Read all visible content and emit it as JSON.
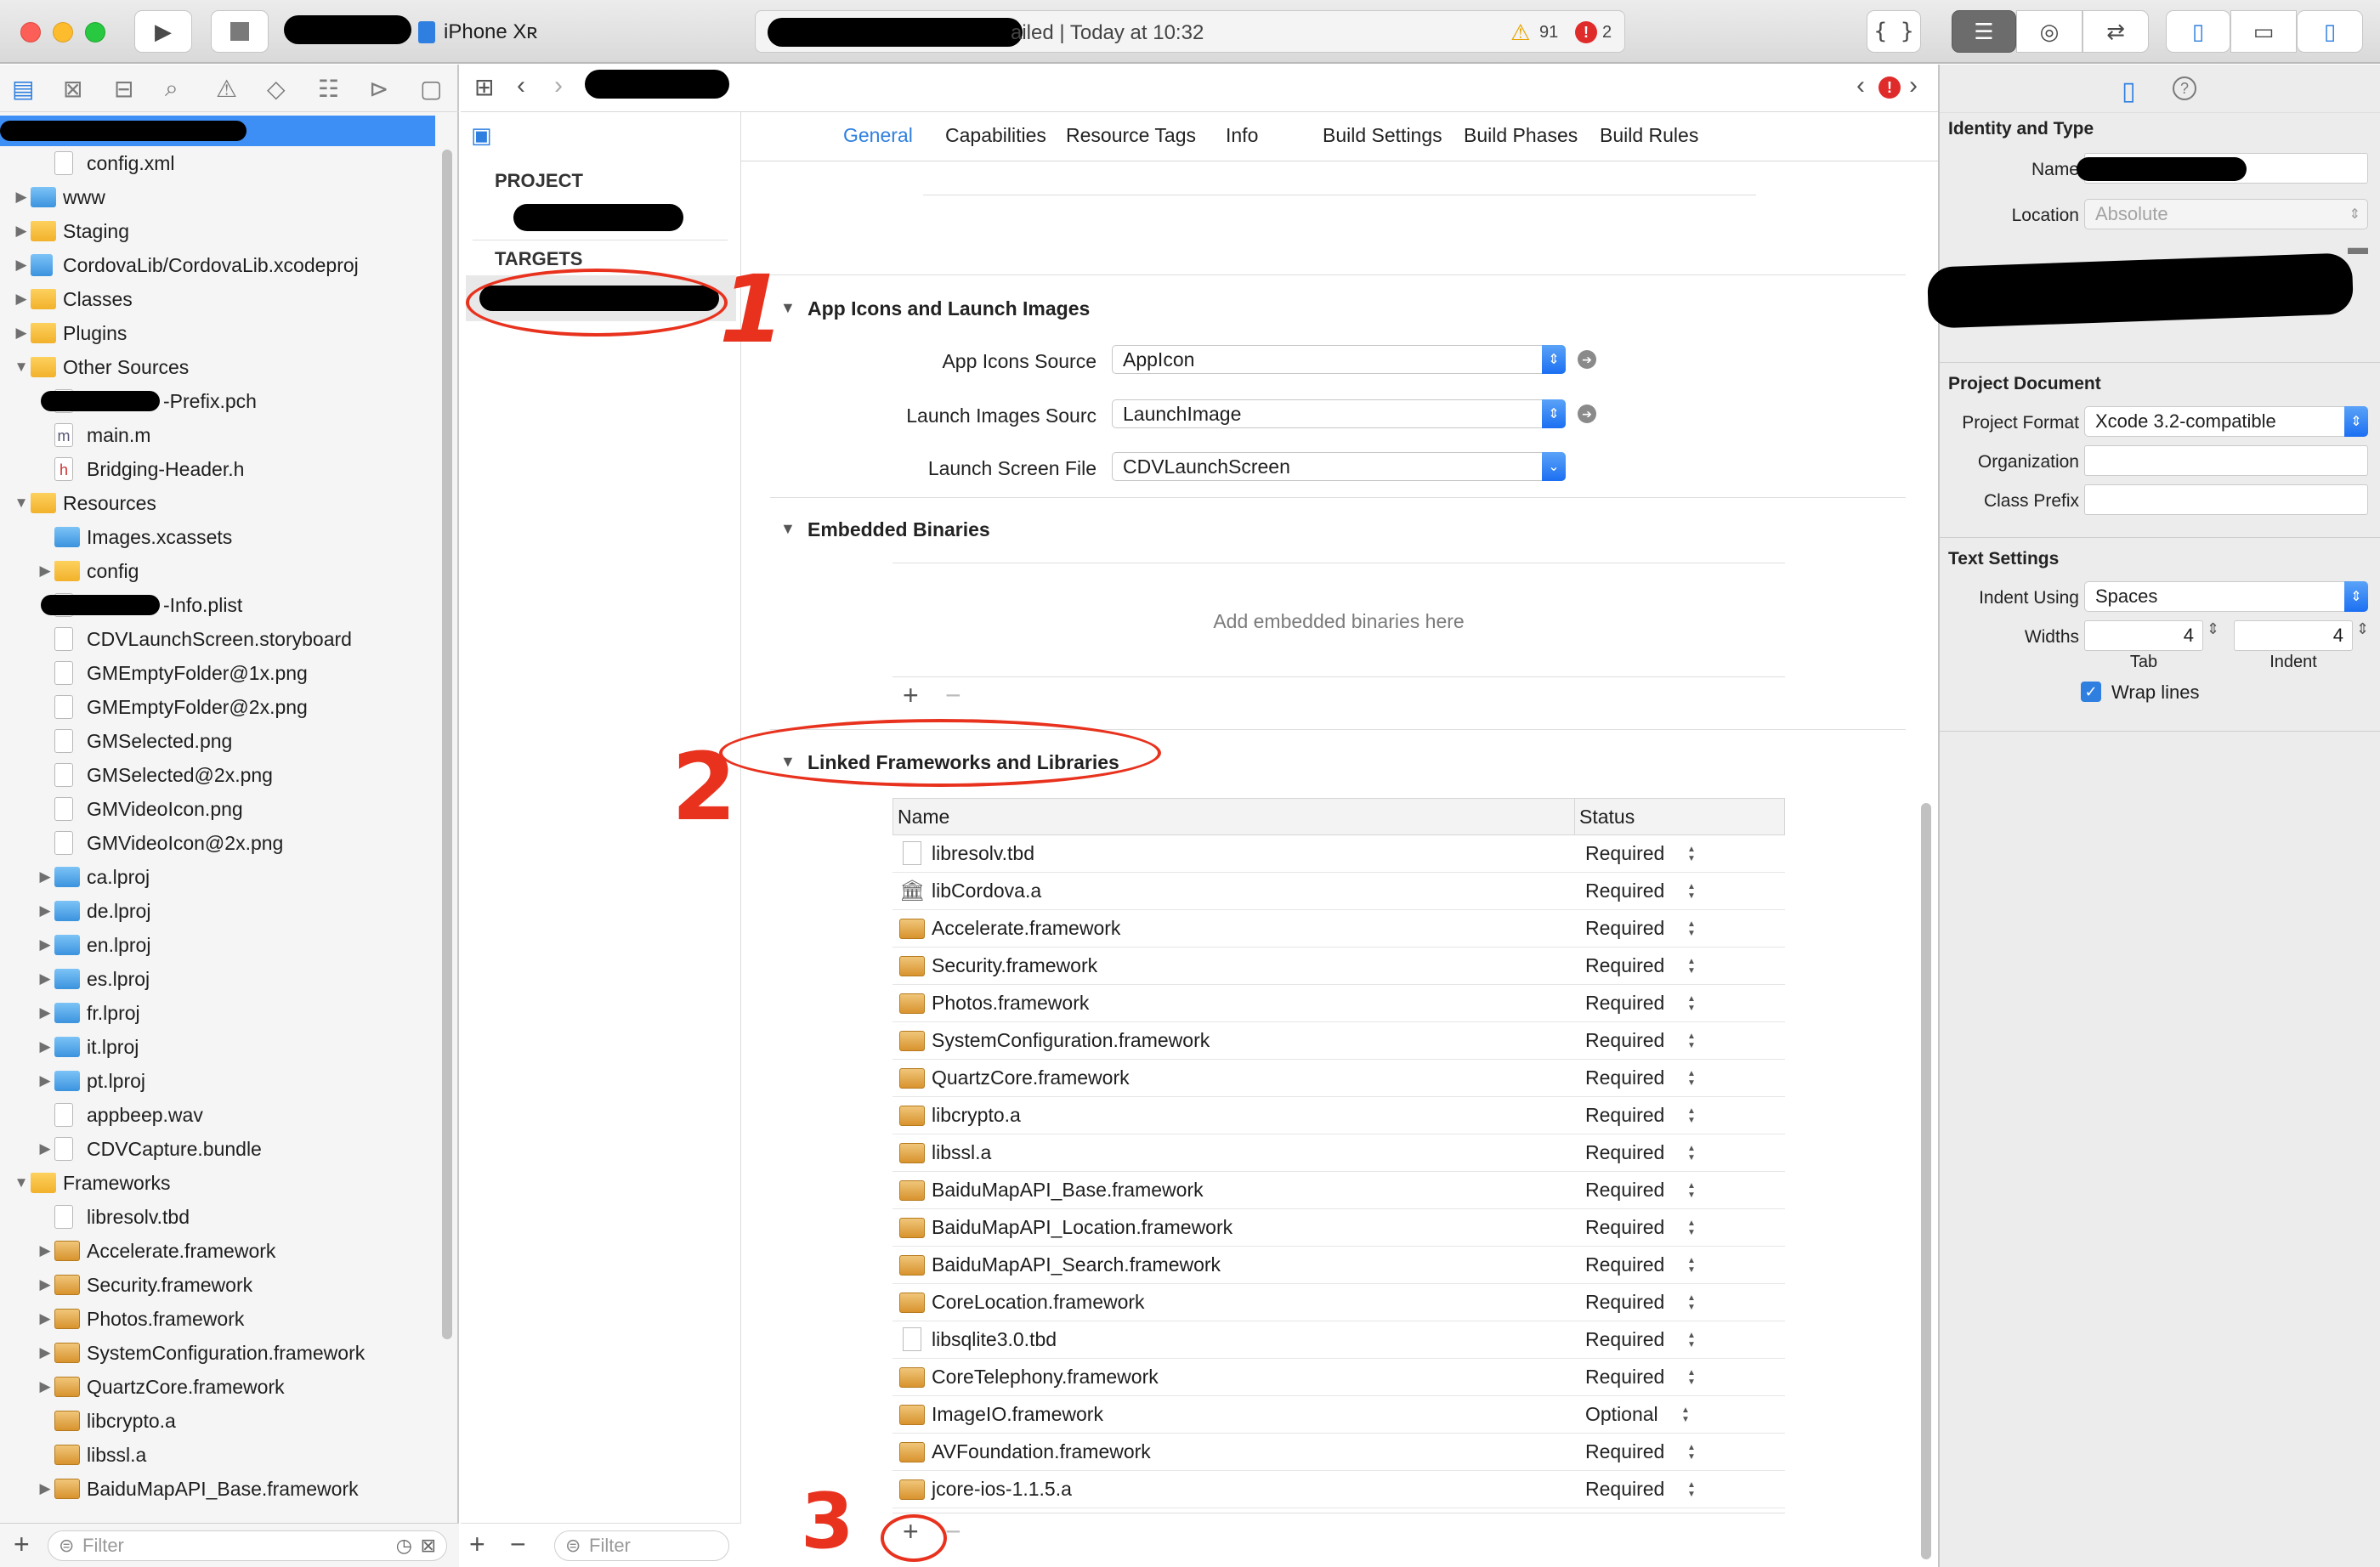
{
  "toolbar": {
    "run_icon": "play-icon",
    "stop_icon": "stop-icon",
    "scheme_device": "iPhone Xʀ",
    "activity_status": "ailed | Today at 10:32",
    "warning_count": "91",
    "error_count": "2"
  },
  "navigator": {
    "tree": [
      {
        "label": "config.xml",
        "indent": 1,
        "icon": "file",
        "disclosure": ""
      },
      {
        "label": "www",
        "indent": 0,
        "icon": "bfold",
        "disclosure": "▶"
      },
      {
        "label": "Staging",
        "indent": 0,
        "icon": "fold",
        "disclosure": "▶"
      },
      {
        "label": "CordovaLib/CordovaLib.xcodeproj",
        "indent": 0,
        "icon": "proj",
        "disclosure": "▶"
      },
      {
        "label": "Classes",
        "indent": 0,
        "icon": "fold",
        "disclosure": "▶"
      },
      {
        "label": "Plugins",
        "indent": 0,
        "icon": "fold",
        "disclosure": "▶"
      },
      {
        "label": "Other Sources",
        "indent": 0,
        "icon": "fold",
        "disclosure": "▼"
      },
      {
        "label": "-Prefix.pch",
        "indent": 1,
        "icon": "file",
        "disclosure": "",
        "redacted": true
      },
      {
        "label": "main.m",
        "indent": 1,
        "icon": "mfile",
        "disclosure": ""
      },
      {
        "label": "Bridging-Header.h",
        "indent": 1,
        "icon": "hfile",
        "disclosure": ""
      },
      {
        "label": "Resources",
        "indent": 0,
        "icon": "fold",
        "disclosure": "▼"
      },
      {
        "label": "Images.xcassets",
        "indent": 1,
        "icon": "bfold",
        "disclosure": ""
      },
      {
        "label": "config",
        "indent": 1,
        "icon": "fold",
        "disclosure": "▶"
      },
      {
        "label": "-Info.plist",
        "indent": 1,
        "icon": "file",
        "disclosure": "",
        "redacted": true
      },
      {
        "label": "CDVLaunchScreen.storyboard",
        "indent": 1,
        "icon": "file",
        "disclosure": ""
      },
      {
        "label": "GMEmptyFolder@1x.png",
        "indent": 1,
        "icon": "file",
        "disclosure": ""
      },
      {
        "label": "GMEmptyFolder@2x.png",
        "indent": 1,
        "icon": "file",
        "disclosure": ""
      },
      {
        "label": "GMSelected.png",
        "indent": 1,
        "icon": "file",
        "disclosure": ""
      },
      {
        "label": "GMSelected@2x.png",
        "indent": 1,
        "icon": "file",
        "disclosure": ""
      },
      {
        "label": "GMVideoIcon.png",
        "indent": 1,
        "icon": "file",
        "disclosure": ""
      },
      {
        "label": "GMVideoIcon@2x.png",
        "indent": 1,
        "icon": "file",
        "disclosure": ""
      },
      {
        "label": "ca.lproj",
        "indent": 1,
        "icon": "bfold",
        "disclosure": "▶"
      },
      {
        "label": "de.lproj",
        "indent": 1,
        "icon": "bfold",
        "disclosure": "▶"
      },
      {
        "label": "en.lproj",
        "indent": 1,
        "icon": "bfold",
        "disclosure": "▶"
      },
      {
        "label": "es.lproj",
        "indent": 1,
        "icon": "bfold",
        "disclosure": "▶"
      },
      {
        "label": "fr.lproj",
        "indent": 1,
        "icon": "bfold",
        "disclosure": "▶"
      },
      {
        "label": "it.lproj",
        "indent": 1,
        "icon": "bfold",
        "disclosure": "▶"
      },
      {
        "label": "pt.lproj",
        "indent": 1,
        "icon": "bfold",
        "disclosure": "▶"
      },
      {
        "label": "appbeep.wav",
        "indent": 1,
        "icon": "file",
        "disclosure": ""
      },
      {
        "label": "CDVCapture.bundle",
        "indent": 1,
        "icon": "file",
        "disclosure": "▶"
      },
      {
        "label": "Frameworks",
        "indent": 0,
        "icon": "fold",
        "disclosure": "▼"
      },
      {
        "label": "libresolv.tbd",
        "indent": 1,
        "icon": "file",
        "disclosure": ""
      },
      {
        "label": "Accelerate.framework",
        "indent": 1,
        "icon": "lib",
        "disclosure": "▶"
      },
      {
        "label": "Security.framework",
        "indent": 1,
        "icon": "lib",
        "disclosure": "▶"
      },
      {
        "label": "Photos.framework",
        "indent": 1,
        "icon": "lib",
        "disclosure": "▶"
      },
      {
        "label": "SystemConfiguration.framework",
        "indent": 1,
        "icon": "lib",
        "disclosure": "▶"
      },
      {
        "label": "QuartzCore.framework",
        "indent": 1,
        "icon": "lib",
        "disclosure": "▶"
      },
      {
        "label": "libcrypto.a",
        "indent": 1,
        "icon": "lib",
        "disclosure": ""
      },
      {
        "label": "libssl.a",
        "indent": 1,
        "icon": "lib",
        "disclosure": ""
      },
      {
        "label": "BaiduMapAPI_Base.framework",
        "indent": 1,
        "icon": "lib",
        "disclosure": "▶"
      }
    ],
    "filter_placeholder": "Filter"
  },
  "targets": {
    "project_header": "PROJECT",
    "targets_header": "TARGETS",
    "filter_placeholder": "Filter"
  },
  "editor": {
    "tabs": [
      "General",
      "Capabilities",
      "Resource Tags",
      "Info",
      "Build Settings",
      "Build Phases",
      "Build Rules"
    ],
    "app_icons_section": "App Icons and Launch Images",
    "app_icons_source_label": "App Icons Source",
    "app_icons_source_value": "AppIcon",
    "launch_images_label": "Launch Images Sourc",
    "launch_images_value": "LaunchImage",
    "launch_screen_label": "Launch Screen File",
    "launch_screen_value": "CDVLaunchScreen",
    "embedded_section": "Embedded Binaries",
    "embedded_placeholder": "Add embedded binaries here",
    "linked_section": "Linked Frameworks and Libraries",
    "col_name": "Name",
    "col_status": "Status",
    "libraries": [
      {
        "name": "libresolv.tbd",
        "status": "Required",
        "icon": "file"
      },
      {
        "name": "libCordova.a",
        "status": "Required",
        "icon": "bank"
      },
      {
        "name": "Accelerate.framework",
        "status": "Required",
        "icon": "lib"
      },
      {
        "name": "Security.framework",
        "status": "Required",
        "icon": "lib"
      },
      {
        "name": "Photos.framework",
        "status": "Required",
        "icon": "lib"
      },
      {
        "name": "SystemConfiguration.framework",
        "status": "Required",
        "icon": "lib"
      },
      {
        "name": "QuartzCore.framework",
        "status": "Required",
        "icon": "lib"
      },
      {
        "name": "libcrypto.a",
        "status": "Required",
        "icon": "lib"
      },
      {
        "name": "libssl.a",
        "status": "Required",
        "icon": "lib"
      },
      {
        "name": "BaiduMapAPI_Base.framework",
        "status": "Required",
        "icon": "lib"
      },
      {
        "name": "BaiduMapAPI_Location.framework",
        "status": "Required",
        "icon": "lib"
      },
      {
        "name": "BaiduMapAPI_Search.framework",
        "status": "Required",
        "icon": "lib"
      },
      {
        "name": "CoreLocation.framework",
        "status": "Required",
        "icon": "lib"
      },
      {
        "name": "libsqlite3.0.tbd",
        "status": "Required",
        "icon": "file"
      },
      {
        "name": "CoreTelephony.framework",
        "status": "Required",
        "icon": "lib"
      },
      {
        "name": "ImageIO.framework",
        "status": "Optional",
        "icon": "lib"
      },
      {
        "name": "AVFoundation.framework",
        "status": "Required",
        "icon": "lib"
      },
      {
        "name": "jcore-ios-1.1.5.a",
        "status": "Required",
        "icon": "lib"
      }
    ],
    "annotations": [
      "1",
      "2",
      "3"
    ]
  },
  "inspector": {
    "identity_header": "Identity and Type",
    "name_label": "Name",
    "location_label": "Location",
    "location_value": "Absolute",
    "project_doc_header": "Project Document",
    "project_format_label": "Project Format",
    "project_format_value": "Xcode 3.2-compatible",
    "organization_label": "Organization",
    "class_prefix_label": "Class Prefix",
    "text_settings_header": "Text Settings",
    "indent_using_label": "Indent Using",
    "indent_using_value": "Spaces",
    "widths_label": "Widths",
    "tab_value": "4",
    "indent_value": "4",
    "tab_caption": "Tab",
    "indent_caption": "Indent",
    "wrap_lines_label": "Wrap lines"
  }
}
